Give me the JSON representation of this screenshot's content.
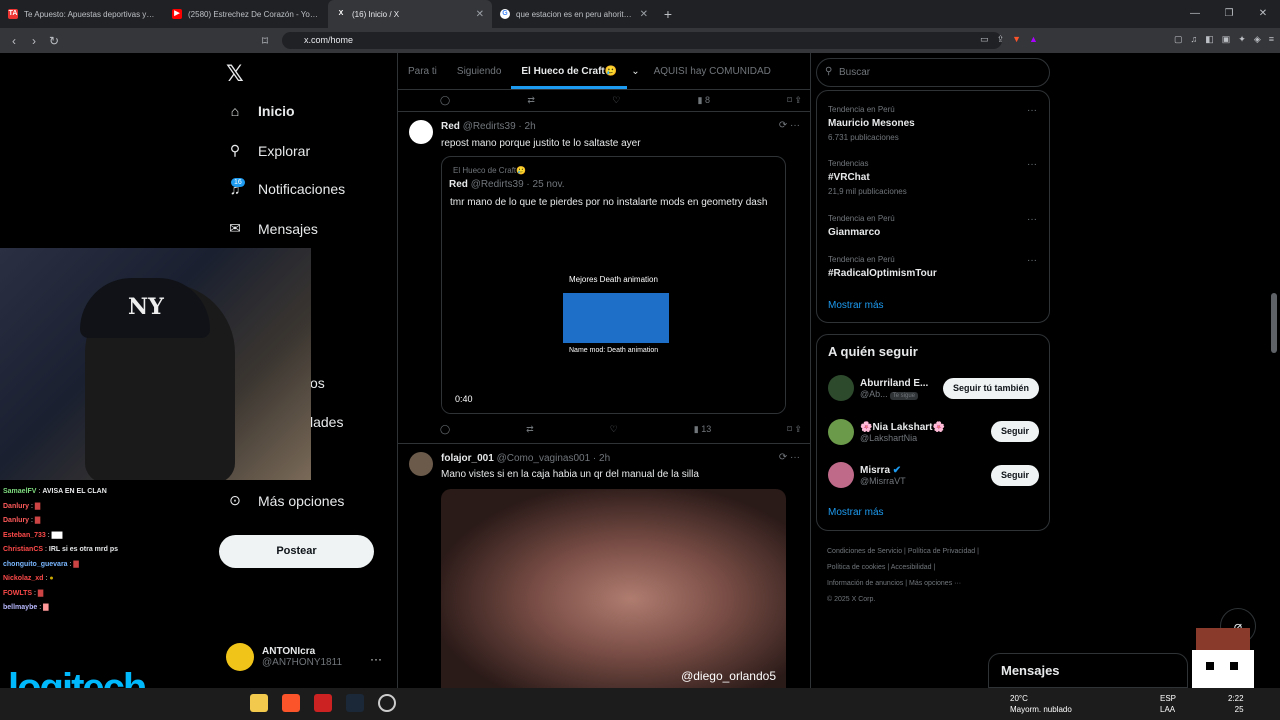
{
  "browser": {
    "tabs": [
      {
        "icon": "TA",
        "title": "Te Apuesto: Apuestas deportivas y Casino",
        "active": false
      },
      {
        "icon": "yt",
        "title": "(2580) Estrechez De Corazón - YouTube",
        "active": false
      },
      {
        "icon": "X",
        "title": "(16) Inicio / X",
        "active": true
      },
      {
        "icon": "G",
        "title": "que estacion es en peru ahorita o sea",
        "active": false
      }
    ],
    "url": "x.com/home"
  },
  "left_nav": {
    "items": [
      {
        "label": "Inicio",
        "icon": "home-icon",
        "active": true
      },
      {
        "label": "Explorar",
        "icon": "search-icon"
      },
      {
        "label": "Notificaciones",
        "icon": "bell-icon",
        "badge": "16"
      },
      {
        "label": "Mensajes",
        "icon": "mail-icon"
      },
      {
        "label": "os",
        "icon": "partially-hidden"
      },
      {
        "label": "lades",
        "icon": "partially-hidden"
      },
      {
        "label": "Más opciones",
        "icon": "more-circle-icon"
      }
    ],
    "post_label": "Postear",
    "profile": {
      "name": "ANTONIcra",
      "handle": "@AN7HONY1811"
    }
  },
  "feed": {
    "tabs": [
      "Para ti",
      "Siguiendo",
      "El Hueco de Craft🥲",
      "AQUISI hay COMUNIDAD"
    ],
    "top_actions": {
      "views": "8"
    },
    "tweets": [
      {
        "name": "Red",
        "handle": "@Redirts39 · 2h",
        "text": "repost mano porque justito te lo saltaste ayer",
        "quote": {
          "community": "El Hueco de Craft🥲",
          "name": "Red",
          "handle": "@Redirts39 · 25 nov.",
          "text": "tmr mano de lo que te pierdes por no instalarte mods en geometry dash",
          "video_title": "Mejores Death animation",
          "video_caption": "Name mod: Death animation",
          "duration": "0:40"
        },
        "views": "13"
      },
      {
        "name": "folajor_001",
        "handle": "@Como_vaginas001 · 2h",
        "text": "Mano vistes si en la caja habia un qr del manual de la silla",
        "watermark": "@diego_orlando5"
      }
    ]
  },
  "right": {
    "search_placeholder": "Buscar",
    "trends": [
      {
        "context": "Tendencia en Perú",
        "name": "Mauricio Mesones",
        "count": "6.731 publicaciones"
      },
      {
        "context": "Tendencias",
        "name": "#VRChat",
        "count": "21,9 mil publicaciones"
      },
      {
        "context": "Tendencia en Perú",
        "name": "Gianmarco",
        "count": ""
      },
      {
        "context": "Tendencia en Perú",
        "name": "#RadicalOptimismTour",
        "count": ""
      }
    ],
    "show_more": "Mostrar más",
    "who_title": "A quién seguir",
    "who": [
      {
        "name": "Aburriland E...",
        "handle": "@Ab...",
        "follows_you": "Te sigue",
        "button": "Seguir tú también"
      },
      {
        "name": "🌸Nia Lakshart🌸",
        "handle": "@LakshartNia",
        "button": "Seguir"
      },
      {
        "name": "Misrra",
        "handle": "@MisrraVT",
        "button": "Seguir"
      }
    ],
    "footer": [
      "Condiciones de Servicio",
      "Política de Privacidad",
      "Política de cookies",
      "Accesibilidad",
      "Información de anuncios",
      "Más opciones ···",
      "© 2025 X Corp."
    ],
    "messages": "Mensajes"
  },
  "chat": [
    {
      "user": "SamaelFV",
      "msg": "AVISA EN EL CLAN",
      "color": "#7fdc7f"
    },
    {
      "user": "Danlury",
      "msg": "",
      "color": "#ff5a5a"
    },
    {
      "user": "Danlury",
      "msg": "",
      "color": "#ff5a5a"
    },
    {
      "user": "Esteban_733",
      "msg": "",
      "color": "#ff4a4a"
    },
    {
      "user": "ChristianCS",
      "msg": "IRL si es otra mrd ps",
      "color": "#ff4a4a"
    },
    {
      "user": "chonguito_guevara",
      "msg": "",
      "color": "#7ab7ff"
    },
    {
      "user": "Nickolaz_xd",
      "msg": "",
      "color": "#ff4a4a"
    },
    {
      "user": "FOWLTS",
      "msg": "",
      "color": "#ff4a4a"
    },
    {
      "user": "bellmaybe",
      "msg": "",
      "color": "#b9b9ff"
    }
  ],
  "overlay_logo": "logitech",
  "taskbar": {
    "weather_temp": "20°C",
    "weather_desc": "Mayorm. nublado",
    "lang1": "ESP",
    "lang2": "LAA",
    "time": "2:22",
    "date": "25"
  }
}
